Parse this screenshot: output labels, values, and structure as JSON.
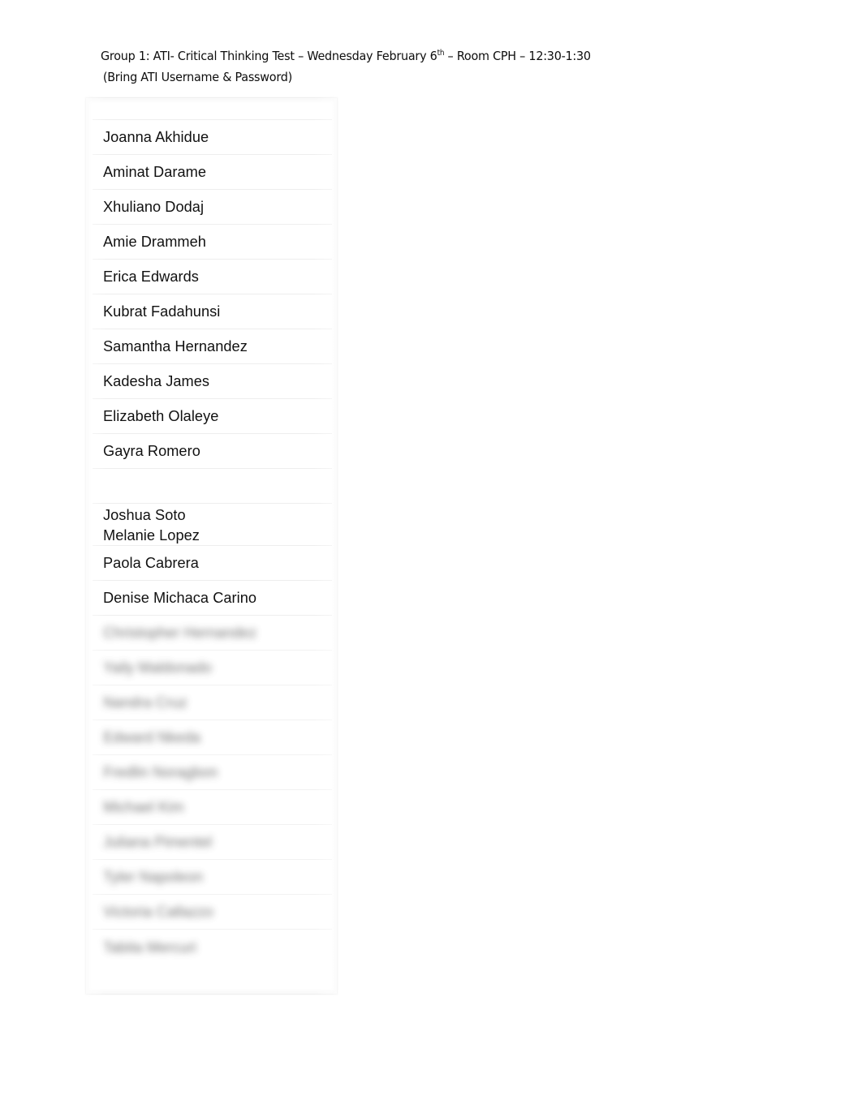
{
  "document": {
    "page_background": "#ffffff",
    "text_color": "#111111"
  },
  "header": {
    "line1_prefix": "Group 1:  ATI- Critical Thinking Test – Wednesday February 6",
    "line1_superscript": "th",
    "line1_suffix": " – Room CPH – 12:30-1:30",
    "line2": "(Bring ATI Username & Password)"
  },
  "roster": {
    "header_row_label": "",
    "rows": [
      {
        "name": "Joanna Akhidue",
        "state": "visible"
      },
      {
        "name": "Aminat Darame",
        "state": "visible"
      },
      {
        "name": "Xhuliano Dodaj",
        "state": "visible"
      },
      {
        "name": "Amie Drammeh",
        "state": "visible"
      },
      {
        "name": "Erica Edwards",
        "state": "visible"
      },
      {
        "name": "Kubrat Fadahunsi",
        "state": "visible"
      },
      {
        "name": "Samantha Hernandez",
        "state": "visible"
      },
      {
        "name": "Kadesha James",
        "state": "visible"
      },
      {
        "name": "Elizabeth Olaleye",
        "state": "visible"
      },
      {
        "name": "Gayra Romero",
        "state": "visible"
      },
      {
        "name": "",
        "state": "empty"
      },
      {
        "name": "Joshua Soto",
        "name2": "Melanie Lopez",
        "state": "visible-pair"
      },
      {
        "name": "Paola Cabrera",
        "state": "visible"
      },
      {
        "name": "Denise Michaca Carino",
        "state": "visible"
      },
      {
        "name": "Christopher Hernandez",
        "state": "redacted"
      },
      {
        "name": "Yaily Maldonado",
        "state": "redacted"
      },
      {
        "name": "Nandra Cruz",
        "state": "redacted"
      },
      {
        "name": "Edward Nkeda",
        "state": "redacted"
      },
      {
        "name": "Fredlin Noragbon",
        "state": "redacted"
      },
      {
        "name": "Michael Kim",
        "state": "redacted"
      },
      {
        "name": "Juliana Pimentel",
        "state": "redacted"
      },
      {
        "name": "Tyler Napoleon",
        "state": "redacted"
      },
      {
        "name": "Victoria Callazzo",
        "state": "redacted"
      },
      {
        "name": "Tabita Mercuri",
        "state": "redacted"
      }
    ]
  }
}
